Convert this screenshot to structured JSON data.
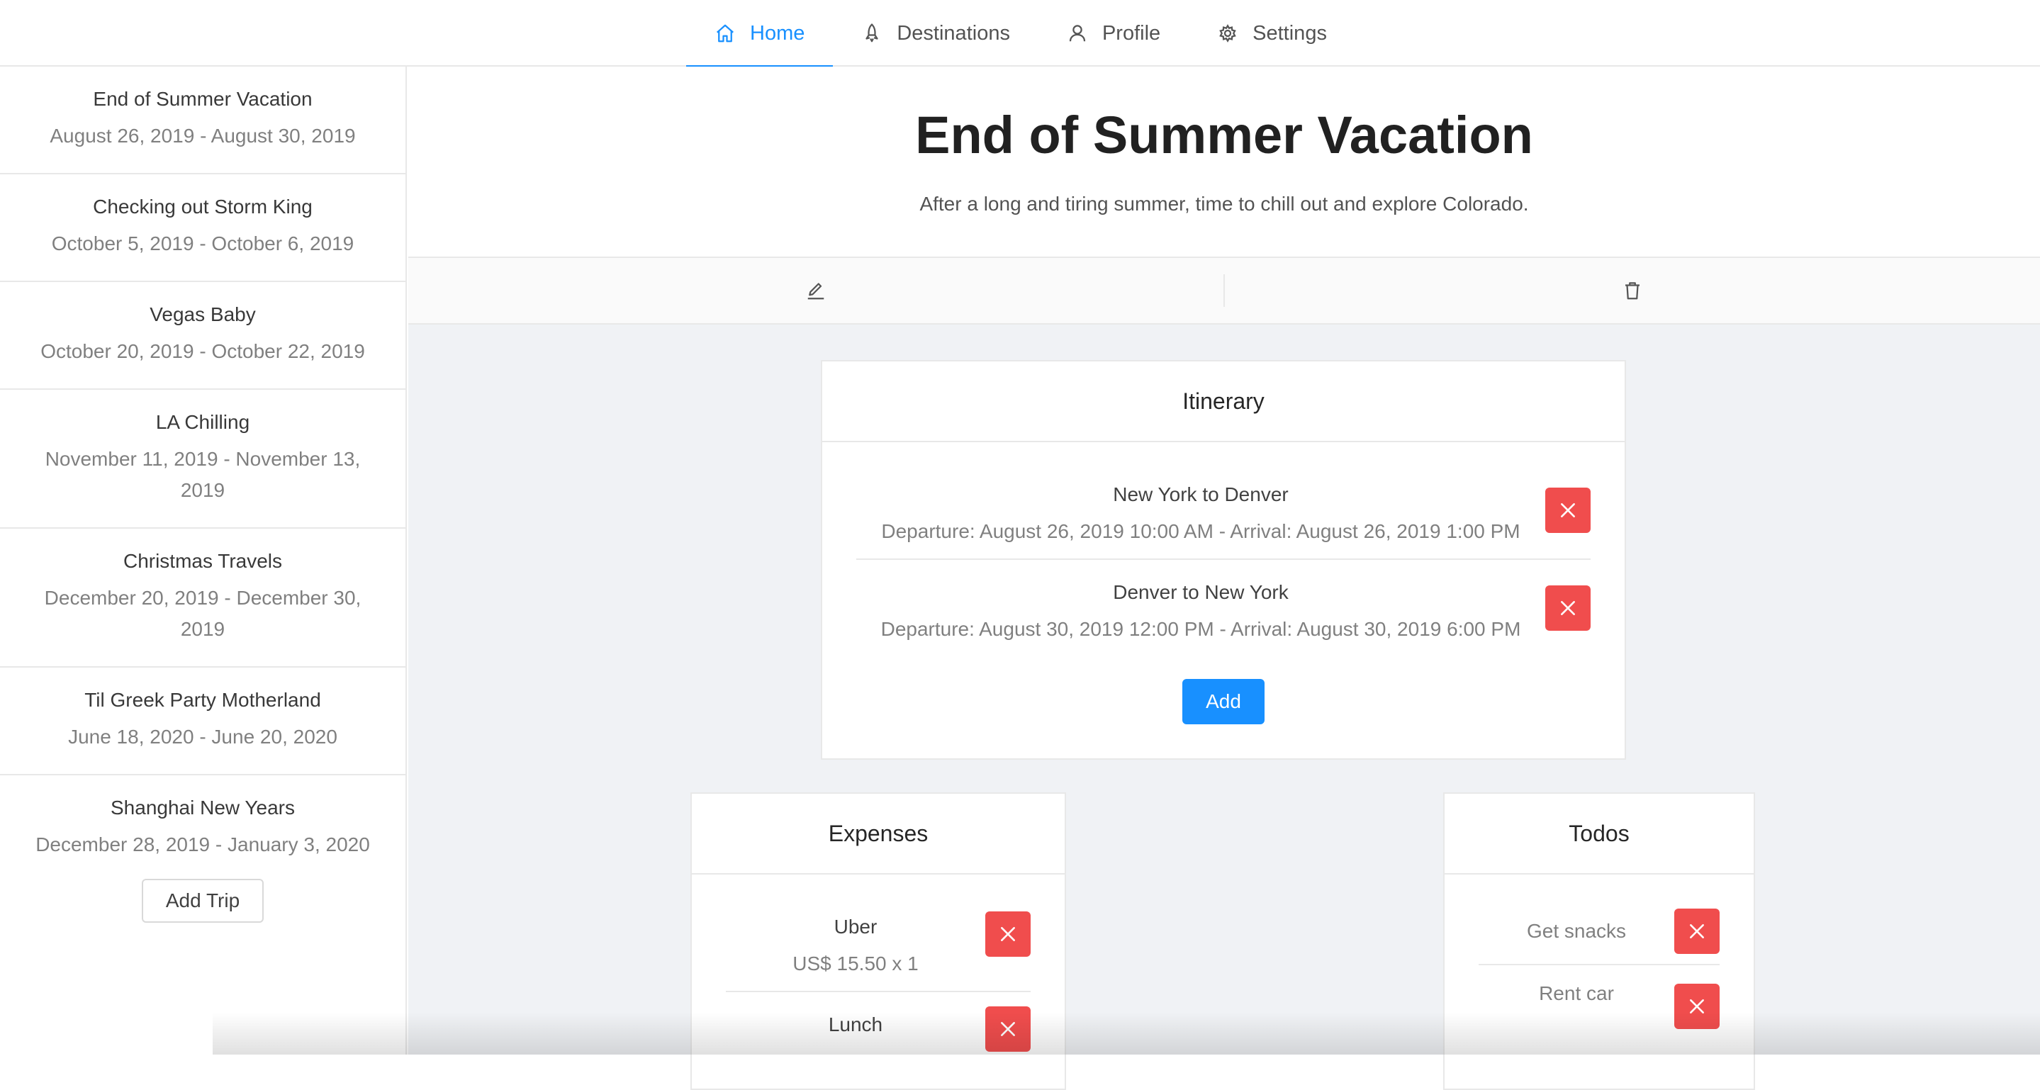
{
  "nav": {
    "items": [
      {
        "label": "Home",
        "icon": "home-icon",
        "active": true
      },
      {
        "label": "Destinations",
        "icon": "rocket-icon"
      },
      {
        "label": "Profile",
        "icon": "user-icon"
      },
      {
        "label": "Settings",
        "icon": "gear-icon"
      }
    ]
  },
  "sidebar": {
    "trips": [
      {
        "name": "End of Summer Vacation",
        "dates": "August 26, 2019 - August 30, 2019"
      },
      {
        "name": "Checking out Storm King",
        "dates": "October 5, 2019 - October 6, 2019"
      },
      {
        "name": "Vegas Baby",
        "dates": "October 20, 2019 - October 22, 2019"
      },
      {
        "name": "LA Chilling",
        "dates": "November 11, 2019 - November 13, 2019"
      },
      {
        "name": "Christmas Travels",
        "dates": "December 20, 2019 - December 30, 2019"
      },
      {
        "name": "Til Greek Party Motherland",
        "dates": "June 18, 2020 - June 20, 2020"
      },
      {
        "name": "Shanghai New Years",
        "dates": "December 28, 2019 - January 3, 2020"
      }
    ],
    "add_trip_label": "Add Trip"
  },
  "trip": {
    "title": "End of Summer Vacation",
    "description": "After a long and tiring summer, time to chill out and explore Colorado."
  },
  "itinerary": {
    "title": "Itinerary",
    "items": [
      {
        "title": "New York to Denver",
        "detail": "Departure: August 26, 2019 10:00 AM - Arrival: August 26, 2019 1:00 PM"
      },
      {
        "title": "Denver to New York",
        "detail": "Departure: August 30, 2019 12:00 PM - Arrival: August 30, 2019 6:00 PM"
      }
    ],
    "add_label": "Add"
  },
  "expenses": {
    "title": "Expenses",
    "items": [
      {
        "name": "Uber",
        "amount": "US$ 15.50 x 1"
      },
      {
        "name": "Lunch",
        "amount": ""
      }
    ]
  },
  "todos": {
    "title": "Todos",
    "items": [
      {
        "name": "Get snacks"
      },
      {
        "name": "Rent car"
      }
    ]
  },
  "colors": {
    "accent": "#1890ff",
    "danger": "#f04d4d",
    "background": "#f0f2f5"
  }
}
